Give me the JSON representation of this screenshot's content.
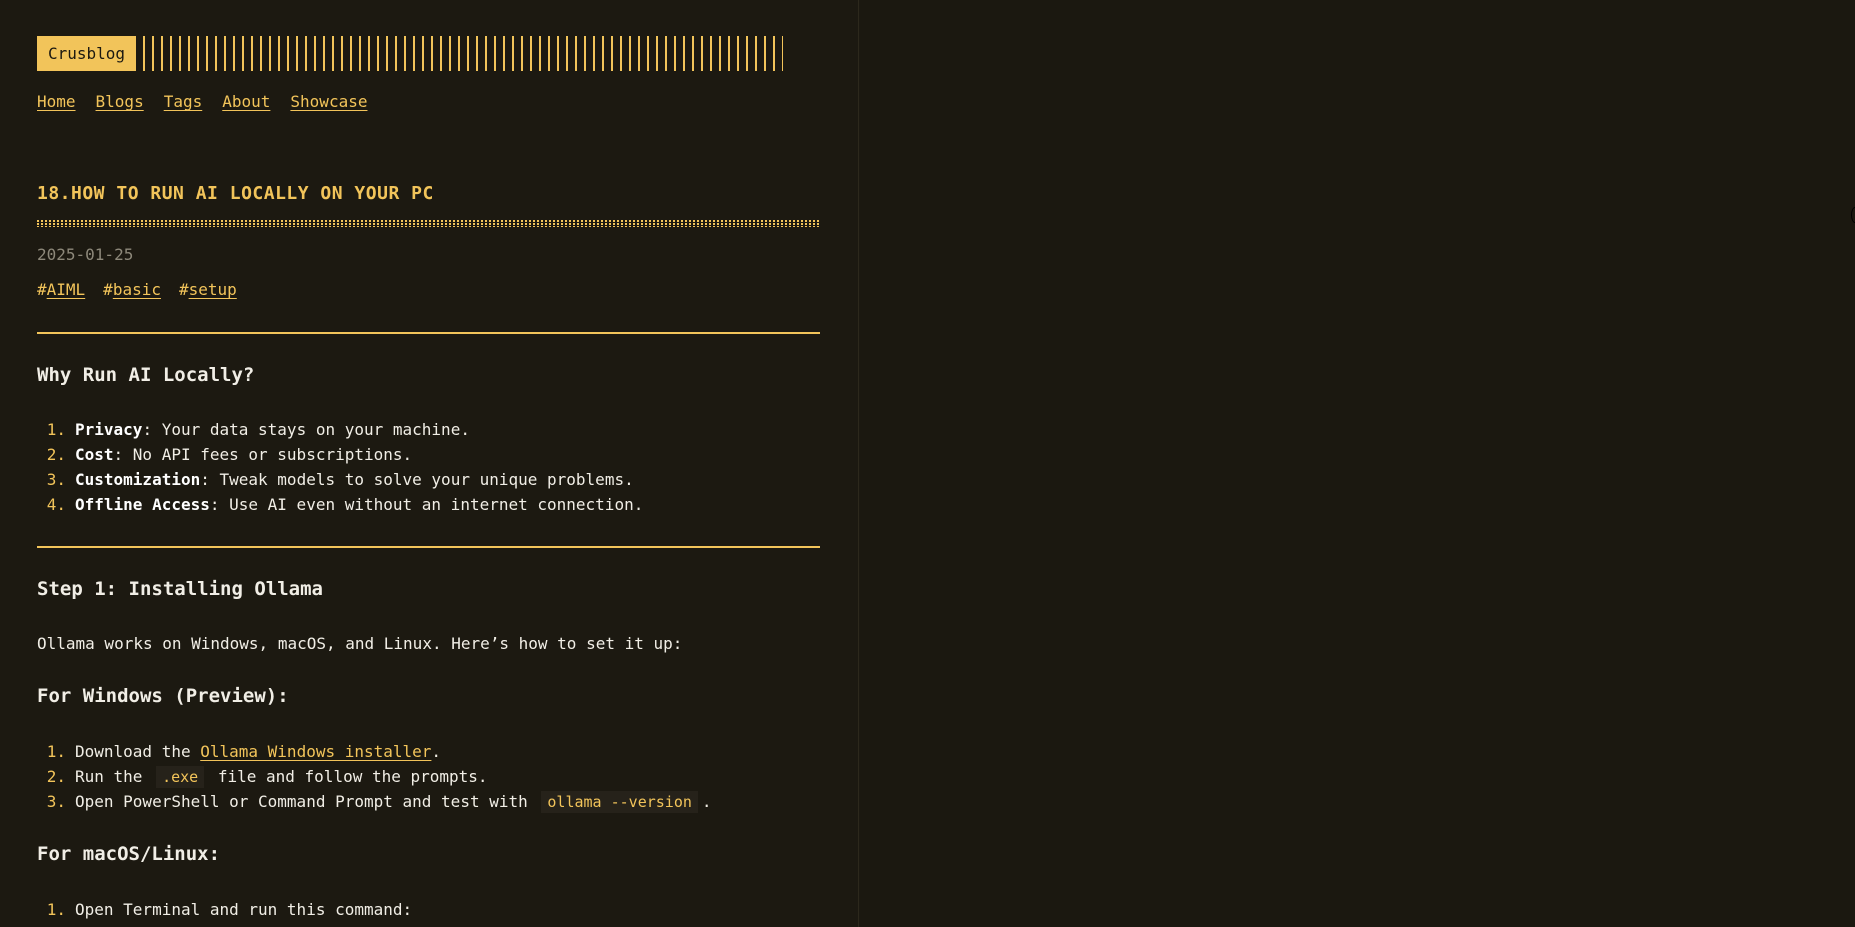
{
  "site": {
    "brand": "Crusblog",
    "nav": [
      "Home",
      "Blogs",
      "Tags",
      "About",
      "Showcase"
    ]
  },
  "post": {
    "title": "18.HOW TO RUN AI LOCALLY ON YOUR PC",
    "date": "2025-01-25",
    "tags": [
      "AIML",
      "basic",
      "setup"
    ],
    "tag_prefix": "#"
  },
  "sections": {
    "why": {
      "heading": "Why Run AI Locally?",
      "items": [
        {
          "num": "1.",
          "bold": "Privacy",
          "rest": ": Your data stays on your machine."
        },
        {
          "num": "2.",
          "bold": "Cost",
          "rest": ": No API fees or subscriptions."
        },
        {
          "num": "3.",
          "bold": "Customization",
          "rest": ": Tweak models to solve your unique problems."
        },
        {
          "num": "4.",
          "bold": "Offline Access",
          "rest": ": Use AI even without an internet connection."
        }
      ]
    },
    "step1": {
      "heading": "Step 1: Installing Ollama",
      "intro": "Ollama works on Windows, macOS, and Linux. Here’s how to set it up:",
      "windows": {
        "heading": "For Windows (Preview):",
        "item1": {
          "num": "1.",
          "pre": "Download the ",
          "link": "Ollama Windows installer",
          "post": "."
        },
        "item2": {
          "num": "2.",
          "pre": "Run the",
          "code": ".exe",
          "post": "file and follow the prompts."
        },
        "item3": {
          "num": "3.",
          "pre": "Open PowerShell or Command Prompt and test with",
          "code": "ollama --version",
          "post": "."
        }
      },
      "mac_linux": {
        "heading": "For macOS/Linux:",
        "item1": {
          "num": "1.",
          "text": "Open Terminal and run this command:"
        }
      }
    }
  }
}
